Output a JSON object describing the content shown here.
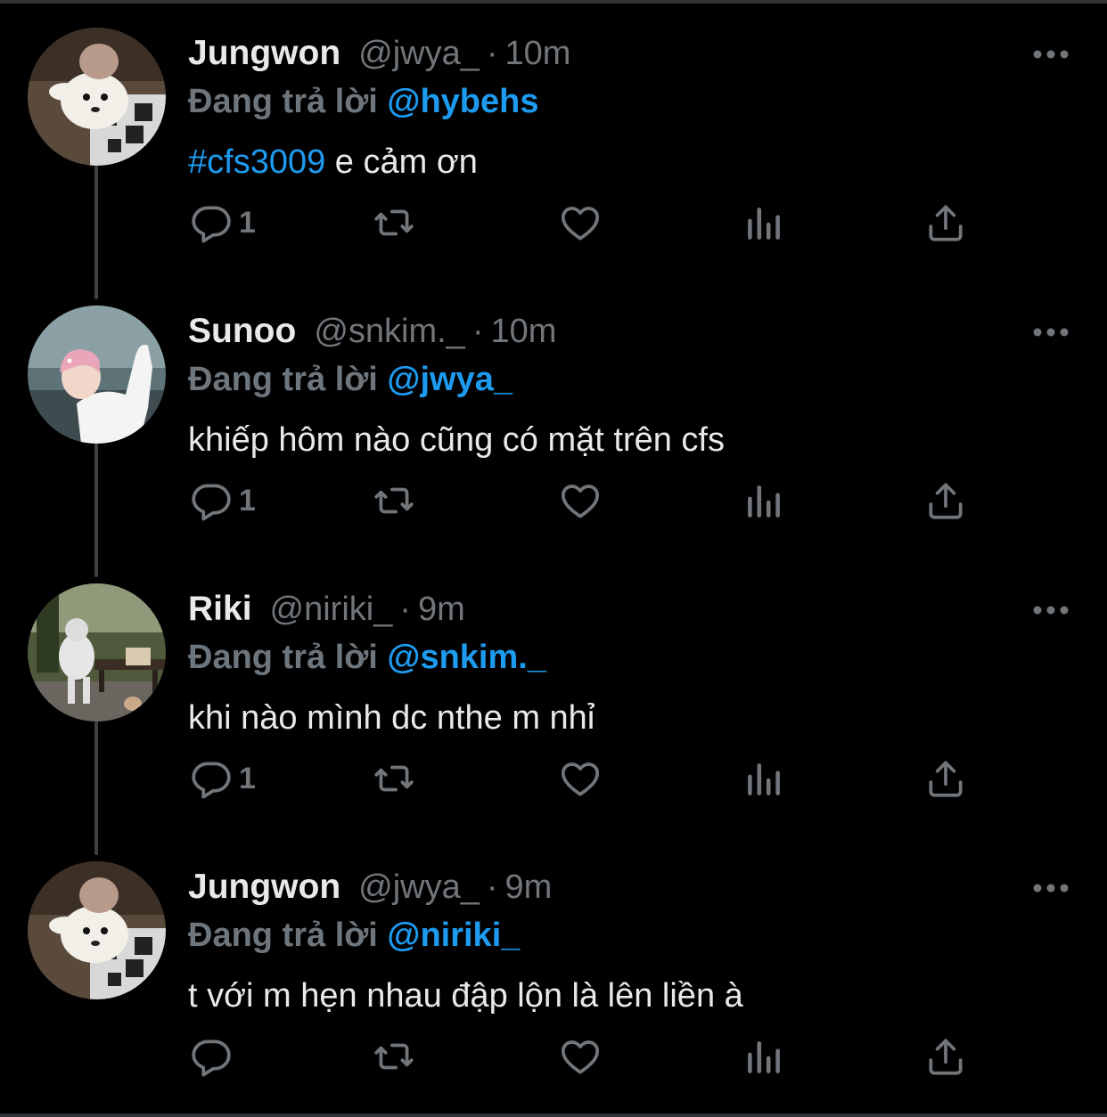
{
  "colors": {
    "background": "#000000",
    "name": "#e7e9ea",
    "muted": "#71767b",
    "accent": "#1d9bf0"
  },
  "tweets": [
    {
      "name": "Jungwon",
      "handle": "@jwya_",
      "separator": "·",
      "time": "10m",
      "reply_label": "Đang trả lời",
      "reply_to": "@hybehs",
      "hashtag": "#cfs3009",
      "text": " e cảm ơn",
      "reply_count": "1",
      "avatar_icon": "avatar-jungwon-dog"
    },
    {
      "name": "Sunoo",
      "handle": "@snkim._",
      "separator": "·",
      "time": "10m",
      "reply_label": "Đang trả lời",
      "reply_to": "@jwya_",
      "hashtag": "",
      "text": "khiếp hôm nào cũng có mặt trên cfs",
      "reply_count": "1",
      "avatar_icon": "avatar-sunoo-pink-hair"
    },
    {
      "name": "Riki",
      "handle": "@niriki_",
      "separator": "·",
      "time": "9m",
      "reply_label": "Đang trả lời",
      "reply_to": "@snkim._",
      "hashtag": "",
      "text": "khi nào mình dc nthe m nhỉ",
      "reply_count": "1",
      "avatar_icon": "avatar-riki-bench"
    },
    {
      "name": "Jungwon",
      "handle": "@jwya_",
      "separator": "·",
      "time": "9m",
      "reply_label": "Đang trả lời",
      "reply_to": "@niriki_",
      "hashtag": "",
      "text": "t với m hẹn nhau đập lộn là lên liền à",
      "reply_count": "",
      "avatar_icon": "avatar-jungwon-dog"
    }
  ]
}
